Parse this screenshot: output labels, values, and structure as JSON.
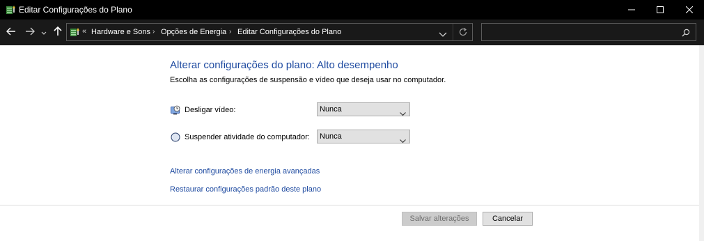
{
  "window": {
    "title": "Editar Configurações do Plano",
    "minimize_icon": "minimize-icon",
    "maximize_icon": "maximize-icon",
    "close_icon": "close-icon"
  },
  "nav": {
    "back_icon": "arrow-left-icon",
    "forward_icon": "arrow-right-icon",
    "recent_icon": "chevron-down-icon",
    "up_icon": "arrow-up-icon"
  },
  "breadcrumb": {
    "overflow": "«",
    "items": [
      "Hardware e Sons",
      "Opções de Energia",
      "Editar Configurações do Plano"
    ],
    "separator": "›"
  },
  "search": {
    "placeholder": ""
  },
  "main": {
    "title": "Alterar configurações do plano: Alto desempenho",
    "subtitle": "Escolha as configurações de suspensão e vídeo que deseja usar no computador.",
    "settings": [
      {
        "label": "Desligar vídeo:",
        "value": "Nunca",
        "icon": "monitor-icon"
      },
      {
        "label": "Suspender atividade do computador:",
        "value": "Nunca",
        "icon": "moon-icon"
      }
    ],
    "links": [
      "Alterar configurações de energia avançadas",
      "Restaurar configurações padrão deste plano"
    ]
  },
  "footer": {
    "save_label": "Salvar alterações",
    "cancel_label": "Cancelar"
  },
  "colors": {
    "titlebar": "#000000",
    "navbar": "#191919",
    "link": "#1e4aa0",
    "heading": "#1e4aa0"
  }
}
